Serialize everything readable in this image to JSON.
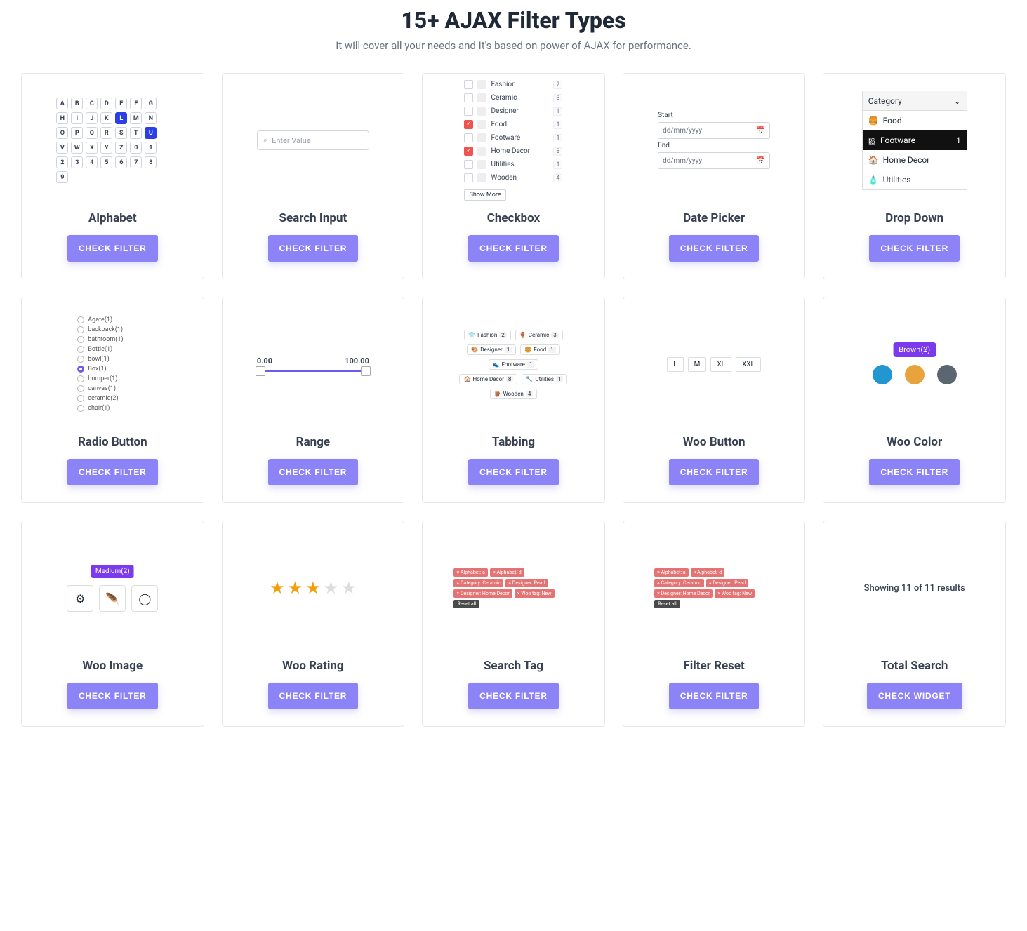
{
  "header": {
    "title": "15+ AJAX Filter Types",
    "subtitle": "It will cover all your needs and It's based on power of AJAX for performance."
  },
  "button_label": "CHECK FILTER",
  "button_label_widget": "CHECK WIDGET",
  "cards": {
    "alphabet": {
      "title": "Alphabet"
    },
    "search_input": {
      "title": "Search Input",
      "placeholder": "Enter Value"
    },
    "checkbox": {
      "title": "Checkbox",
      "show_more": "Show More",
      "items": [
        {
          "label": "Fashion",
          "count": "2",
          "checked": false
        },
        {
          "label": "Ceramic",
          "count": "3",
          "checked": false
        },
        {
          "label": "Designer",
          "count": "1",
          "checked": false
        },
        {
          "label": "Food",
          "count": "1",
          "checked": true
        },
        {
          "label": "Footware",
          "count": "1",
          "checked": false
        },
        {
          "label": "Home Decor",
          "count": "8",
          "checked": true
        },
        {
          "label": "Utilities",
          "count": "1",
          "checked": false
        },
        {
          "label": "Wooden",
          "count": "4",
          "checked": false
        }
      ]
    },
    "date_picker": {
      "title": "Date Picker",
      "start": "Start",
      "end": "End",
      "placeholder": "dd/mm/yyyy"
    },
    "dropdown": {
      "title": "Drop Down",
      "label": "Category",
      "items": [
        "Food",
        "Footware",
        "Home Decor",
        "Utilities"
      ],
      "sel_count": "1"
    },
    "radio": {
      "title": "Radio Button",
      "items": [
        "Agate(1)",
        "backpack(1)",
        "bathroom(1)",
        "Bottle(1)",
        "bowl(1)",
        "Box(1)",
        "bumper(1)",
        "canvas(1)",
        "ceramic(2)",
        "chair(1)"
      ],
      "selected": 5
    },
    "range": {
      "title": "Range",
      "min": "0.00",
      "max": "100.00"
    },
    "tabbing": {
      "title": "Tabbing",
      "items": [
        {
          "label": "Fashion",
          "cnt": "2"
        },
        {
          "label": "Ceramic",
          "cnt": "3"
        },
        {
          "label": "Designer",
          "cnt": "1"
        },
        {
          "label": "Food",
          "cnt": "1"
        },
        {
          "label": "Footware",
          "cnt": "1"
        },
        {
          "label": "Home Decor",
          "cnt": "8"
        },
        {
          "label": "Utilities",
          "cnt": "1"
        },
        {
          "label": "Wooden",
          "cnt": "4"
        }
      ]
    },
    "woo_button": {
      "title": "Woo Button",
      "items": [
        "L",
        "M",
        "XL",
        "XXL"
      ]
    },
    "woo_color": {
      "title": "Woo Color",
      "tip": "Brown(2)",
      "colors": [
        "#2196d1",
        "#e8a33d",
        "#5b6670"
      ]
    },
    "woo_image": {
      "title": "Woo Image",
      "tip": "Medium(2)"
    },
    "woo_rating": {
      "title": "Woo Rating",
      "filled": 3,
      "total": 5
    },
    "search_tag": {
      "title": "Search Tag",
      "reset": "Reset all",
      "tags": [
        "× Alphabet: a",
        "× Alphabet: d",
        "× Category: Ceramic",
        "× Designer: Pearl",
        "× Designer: Home Decor",
        "× Woo tag: New"
      ]
    },
    "filter_reset": {
      "title": "Filter Reset",
      "reset": "Reset all",
      "tags": [
        "× Alphabet: a",
        "× Alphabet: d",
        "× Category: Ceramic",
        "× Designer: Pearl",
        "× Designer: Home Decor",
        "× Woo tag: New"
      ]
    },
    "total_search": {
      "title": "Total Search",
      "text": "Showing 11 of 11 results"
    }
  },
  "alpha_cells": [
    "A",
    "B",
    "C",
    "D",
    "E",
    "F",
    "G",
    "H",
    "I",
    "J",
    "K",
    "L",
    "M",
    "N",
    "O",
    "P",
    "Q",
    "R",
    "S",
    "T",
    "U",
    "V",
    "W",
    "X",
    "Y",
    "Z",
    "0",
    "1",
    "2",
    "3",
    "4",
    "5",
    "6",
    "7",
    "8",
    "9"
  ],
  "alpha_active": [
    "L",
    "U"
  ]
}
